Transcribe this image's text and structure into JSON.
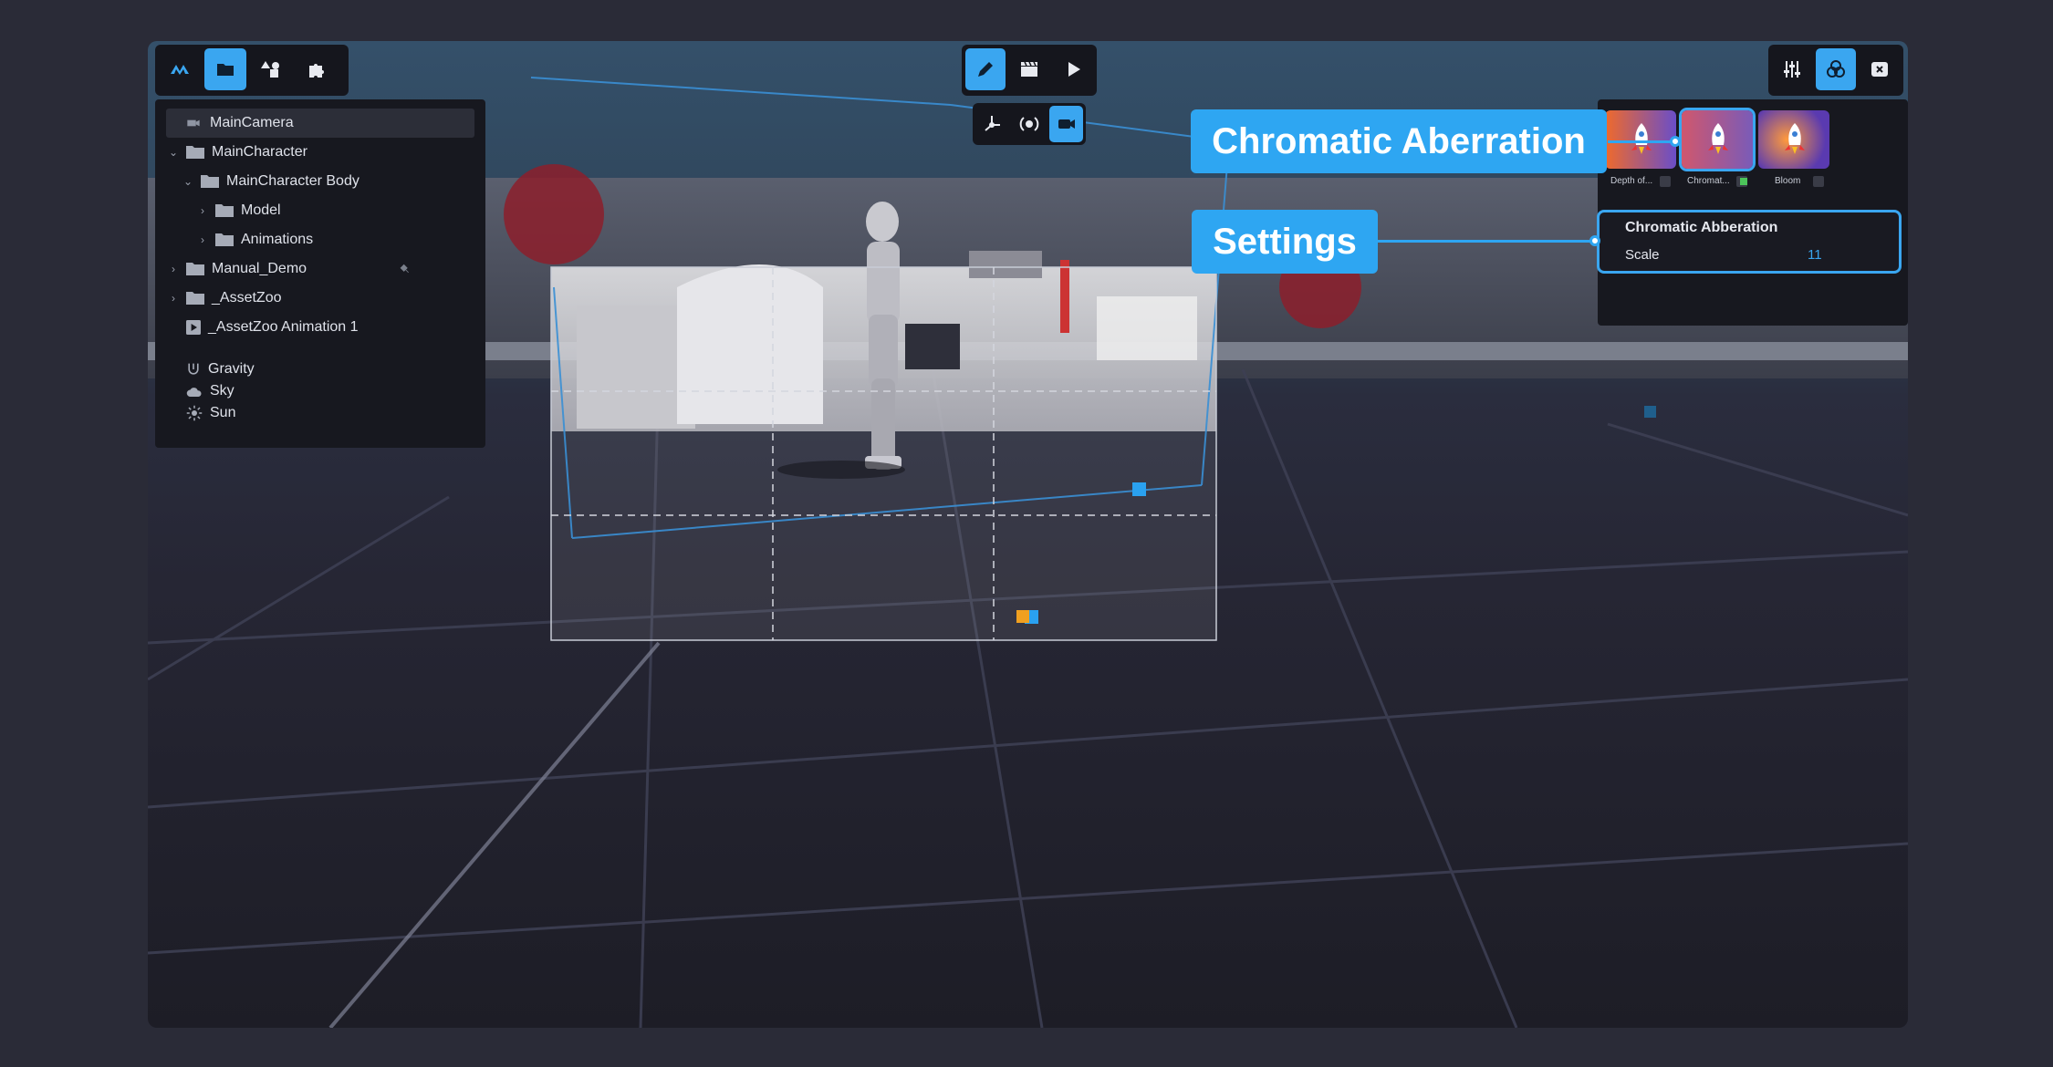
{
  "toolbar_left": {
    "items": [
      "logo-icon",
      "folder-icon",
      "shapes-icon",
      "puzzle-icon"
    ]
  },
  "toolbar_center": {
    "items": [
      "pencil-icon",
      "clapperboard-icon",
      "play-icon"
    ]
  },
  "toolbar_view": {
    "items": [
      "transform-icon",
      "orbit-icon",
      "camera-icon"
    ]
  },
  "toolbar_right": {
    "items": [
      "sliders-icon",
      "color-circles-icon",
      "close-icon"
    ]
  },
  "hierarchy": {
    "items": [
      {
        "label": "MainCamera",
        "icon": "camera-icon",
        "chevron": ""
      },
      {
        "label": "MainCharacter",
        "icon": "folder-icon",
        "chevron": "v"
      },
      {
        "label": "MainCharacter Body",
        "icon": "folder-icon",
        "chevron": "v"
      },
      {
        "label": "Model",
        "icon": "folder-icon",
        "chevron": ">"
      },
      {
        "label": "Animations",
        "icon": "folder-icon",
        "chevron": ">"
      },
      {
        "label": "Manual_Demo",
        "icon": "folder-icon",
        "chevron": ">"
      },
      {
        "label": "_AssetZoo",
        "icon": "folder-icon",
        "chevron": ">"
      },
      {
        "label": "_AssetZoo Animation 1",
        "icon": "film-icon",
        "chevron": ""
      }
    ],
    "environment": [
      {
        "label": "Gravity",
        "icon": "gravity-icon"
      },
      {
        "label": "Sky",
        "icon": "cloud-icon"
      },
      {
        "label": "Sun",
        "icon": "sun-icon"
      }
    ]
  },
  "effects": {
    "items": [
      {
        "label": "Depth of...",
        "enabled": false
      },
      {
        "label": "Chromat...",
        "enabled": true
      },
      {
        "label": "Bloom",
        "enabled": false
      }
    ]
  },
  "settings_panel": {
    "title": "Chromatic Abberation",
    "param_label": "Scale",
    "param_value": "11"
  },
  "callouts": {
    "effect": "Chromatic Aberration",
    "settings": "Settings"
  },
  "colors": {
    "accent": "#3aa6f0",
    "callout": "#2ea6f2",
    "panel": "#17181f",
    "toggle_on": "#4cc45a"
  }
}
